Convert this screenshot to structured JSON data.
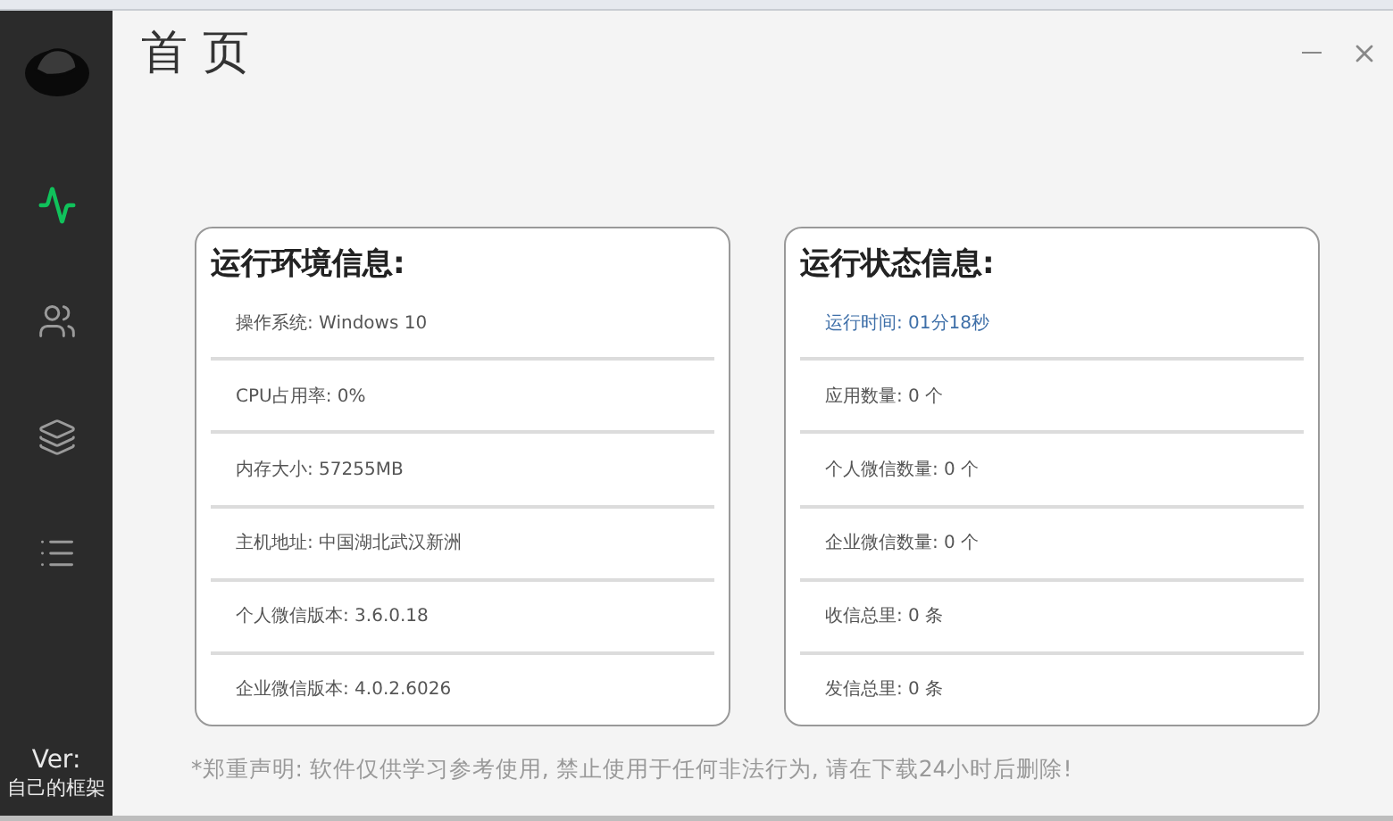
{
  "sidebar": {
    "items": [
      {
        "kind": "activity",
        "selected": true
      },
      {
        "kind": "users",
        "selected": false
      },
      {
        "kind": "layers",
        "selected": false
      },
      {
        "kind": "list",
        "selected": false
      }
    ],
    "version_label": "Ver:",
    "version_value": "自己的框架"
  },
  "page_title": "首 页",
  "cards": [
    {
      "title": "运行环境信息:",
      "rows": [
        {
          "text": "操作系统: Windows 10",
          "highlighted": false
        },
        {
          "text": "CPU占用率: 0%",
          "highlighted": false
        },
        {
          "text": "内存大小: 57255MB",
          "highlighted": false
        },
        {
          "text": "主机地址: 中国湖北武汉新洲",
          "highlighted": false
        },
        {
          "text": "个人微信版本: 3.6.0.18",
          "highlighted": false
        },
        {
          "text": "企业微信版本: 4.0.2.6026",
          "highlighted": false
        }
      ]
    },
    {
      "title": "运行状态信息:",
      "rows": [
        {
          "text": "运行时间: 01分18秒",
          "highlighted": true
        },
        {
          "text": "应用数量: 0 个",
          "highlighted": false
        },
        {
          "text": "个人微信数量: 0 个",
          "highlighted": false
        },
        {
          "text": "企业微信数量: 0 个",
          "highlighted": false
        },
        {
          "text": "收信总里: 0 条",
          "highlighted": false
        },
        {
          "text": "发信总里: 0 条",
          "highlighted": false
        }
      ]
    }
  ],
  "disclaimer": "*郑重声明: 软件仅供学习参考使用, 禁止使用于任何非法行为, 请在下载24小时后删除!"
}
